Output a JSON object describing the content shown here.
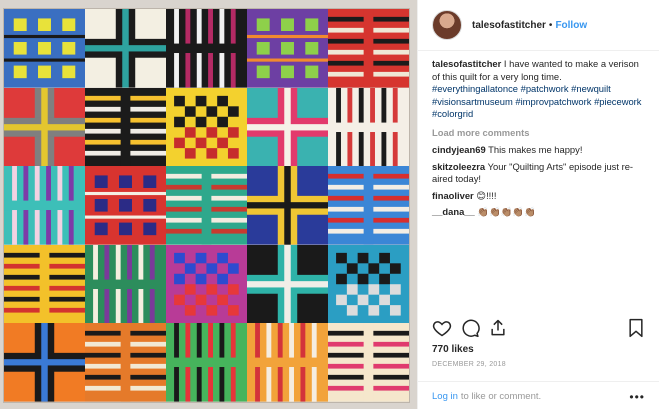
{
  "post": {
    "username": "talesofastitcher",
    "follow_label": "Follow",
    "separator": "•",
    "caption_user": "talesofastitcher",
    "caption_text": "I have wanted to make a verison of this quilt for a very long time.",
    "hashtags": [
      "#everythingallatonce",
      "#patchwork",
      "#newquilt",
      "#visionsartmuseum",
      "#improvpatchwork",
      "#piecework",
      "#colorgrid"
    ],
    "load_more": "Load more comments",
    "comments": [
      {
        "user": "cindyjean69",
        "text": "This makes me happy!"
      },
      {
        "user": "skitzoleezra",
        "text": "Your \"Quilting Arts\" episode just re-aired today!"
      },
      {
        "user": "finaoliver",
        "text": "😊!!!!"
      },
      {
        "user": "__dana__",
        "text": "👏🏽👏🏽👏🏽👏🏽👏🏽"
      }
    ],
    "likes": "770 likes",
    "date": "DECEMBER 29, 2018",
    "login_link": "Log in",
    "login_rest": "to like or comment.",
    "more_label": "•••"
  },
  "icons": {
    "like": "heart-icon",
    "comment": "comment-icon",
    "share": "share-icon",
    "save": "bookmark-icon",
    "more": "more-options-icon"
  },
  "quilt_blocks": [
    {
      "bg": "#3a6fc1",
      "fg": "#e8e23a",
      "accent": "#1a1a1a",
      "pattern": "grid9"
    },
    {
      "bg": "#f3efe2",
      "fg": "#1b1b1b",
      "accent": "#2ea3a0",
      "pattern": "cross"
    },
    {
      "bg": "#1a1a1a",
      "fg": "#f2f2f2",
      "accent": "#b52a64",
      "pattern": "vstripes"
    },
    {
      "bg": "#6d3fa3",
      "fg": "#8ed04a",
      "accent": "#f28a2e",
      "pattern": "grid9"
    },
    {
      "bg": "#d6352f",
      "fg": "#1b1b1b",
      "accent": "#efe7d5",
      "pattern": "hstripes"
    },
    {
      "bg": "#de3a3a",
      "fg": "#7f7f7f",
      "accent": "#e3c62f",
      "pattern": "cross"
    },
    {
      "bg": "#1b1b1b",
      "fg": "#f6c12f",
      "accent": "#f0ede6",
      "pattern": "hstripes"
    },
    {
      "bg": "#f3d12e",
      "fg": "#1b1b1b",
      "accent": "#c62d2d",
      "pattern": "checker"
    },
    {
      "bg": "#3ab2b0",
      "fg": "#e23a6c",
      "accent": "#f5f1e8",
      "pattern": "cross"
    },
    {
      "bg": "#f4efe6",
      "fg": "#1b1b1b",
      "accent": "#d53a3a",
      "pattern": "vstripes"
    },
    {
      "bg": "#3dbfb8",
      "fg": "#f3d2e2",
      "accent": "#7e3aa8",
      "pattern": "vstripes"
    },
    {
      "bg": "#d8342f",
      "fg": "#2b2b86",
      "accent": "#f4efe3",
      "pattern": "grid9"
    },
    {
      "bg": "#2ea88c",
      "fg": "#f3ece0",
      "accent": "#c83a2f",
      "pattern": "hstripes"
    },
    {
      "bg": "#2a3b9a",
      "fg": "#f0c634",
      "accent": "#1a1a1a",
      "pattern": "cross"
    },
    {
      "bg": "#3b86d6",
      "fg": "#d72e2e",
      "accent": "#f3ede4",
      "pattern": "hstripes"
    },
    {
      "bg": "#f3c12a",
      "fg": "#1a1a1a",
      "accent": "#d3332f",
      "pattern": "hstripes"
    },
    {
      "bg": "#2c8d5c",
      "fg": "#f5efe0",
      "accent": "#7a3a9a",
      "pattern": "vstripes"
    },
    {
      "bg": "#b83b97",
      "fg": "#2d4bd0",
      "accent": "#e6383a",
      "pattern": "checker"
    },
    {
      "bg": "#1a1a1a",
      "fg": "#2eb3a8",
      "accent": "#f0eee8",
      "pattern": "cross"
    },
    {
      "bg": "#2b9ec3",
      "fg": "#1a1a1a",
      "accent": "#dcdcdc",
      "pattern": "checker"
    },
    {
      "bg": "#f17b24",
      "fg": "#1a1a1a",
      "accent": "#3a7ad6",
      "pattern": "cross"
    },
    {
      "bg": "#e57a2a",
      "fg": "#1a1a1a",
      "accent": "#f2e9d4",
      "pattern": "hstripes"
    },
    {
      "bg": "#46b45c",
      "fg": "#1a1a1a",
      "accent": "#e7343a",
      "pattern": "vstripes"
    },
    {
      "bg": "#f2a33a",
      "fg": "#d3333a",
      "accent": "#f5ede1",
      "pattern": "vstripes"
    },
    {
      "bg": "#f5e7cc",
      "fg": "#1a1a1a",
      "accent": "#e03b6e",
      "pattern": "hstripes"
    }
  ]
}
